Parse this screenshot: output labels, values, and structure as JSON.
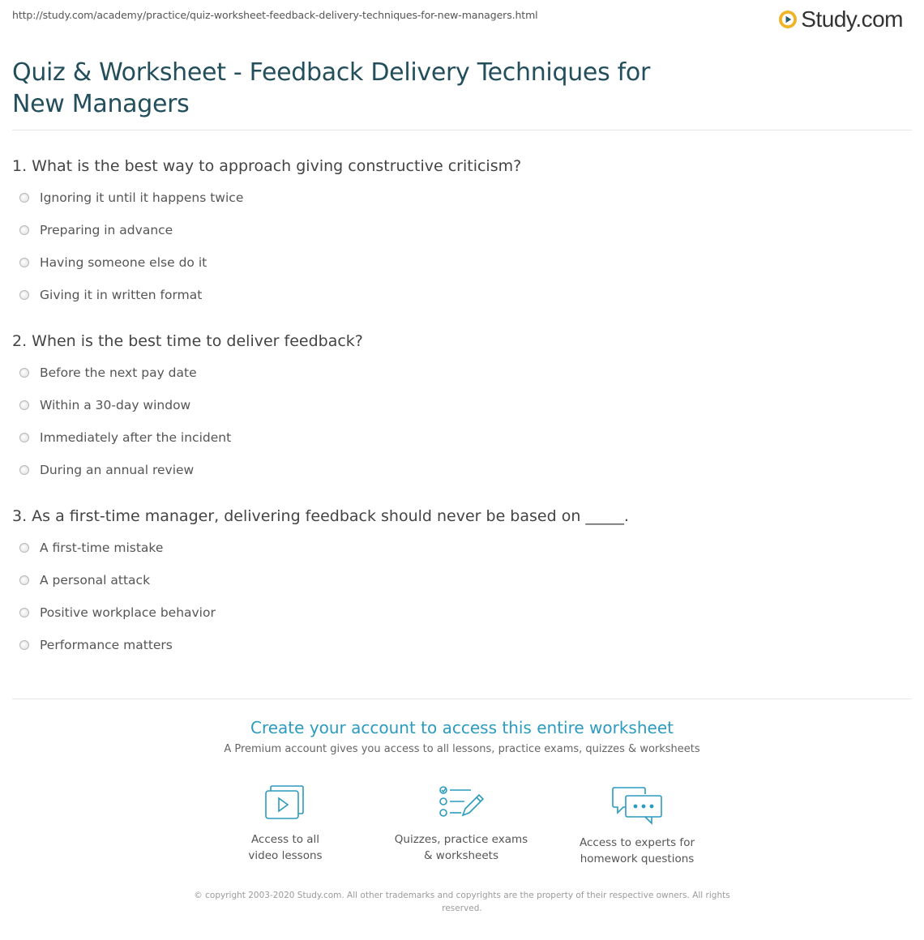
{
  "header": {
    "url": "http://study.com/academy/practice/quiz-worksheet-feedback-delivery-techniques-for-new-managers.html",
    "logo_text": "Study.com",
    "logo_icon": "play-circle-logo-icon",
    "logo_color": "#f0b324"
  },
  "page": {
    "title": "Quiz & Worksheet - Feedback Delivery Techniques for New Managers",
    "title_color": "#234e5c"
  },
  "questions": [
    {
      "text": "1. What is the best way to approach giving constructive criticism?",
      "options": [
        "Ignoring it until it happens twice",
        "Preparing in advance",
        "Having someone else do it",
        "Giving it in written format"
      ]
    },
    {
      "text": "2. When is the best time to deliver feedback?",
      "options": [
        "Before the next pay date",
        "Within a 30-day window",
        "Immediately after the incident",
        "During an annual review"
      ]
    },
    {
      "text": "3. As a first-time manager, delivering feedback should never be based on _____.",
      "options": [
        "A first-time mistake",
        "A personal attack",
        "Positive workplace behavior",
        "Performance matters"
      ]
    }
  ],
  "cta": {
    "title": "Create your account to access this entire worksheet",
    "subtitle": "A Premium account gives you access to all lessons, practice exams, quizzes & worksheets",
    "accent_color": "#2b9bbf",
    "features": [
      {
        "icon": "video-lessons-icon",
        "line1": "Access to all",
        "line2": "video lessons"
      },
      {
        "icon": "quiz-checklist-icon",
        "line1": "Quizzes, practice exams",
        "line2": "& worksheets"
      },
      {
        "icon": "expert-chat-icon",
        "line1": "Access to experts for",
        "line2": "homework questions"
      }
    ]
  },
  "footer": {
    "copyright": "© copyright 2003-2020 Study.com. All other trademarks and copyrights are the property of their respective owners. All rights reserved."
  }
}
